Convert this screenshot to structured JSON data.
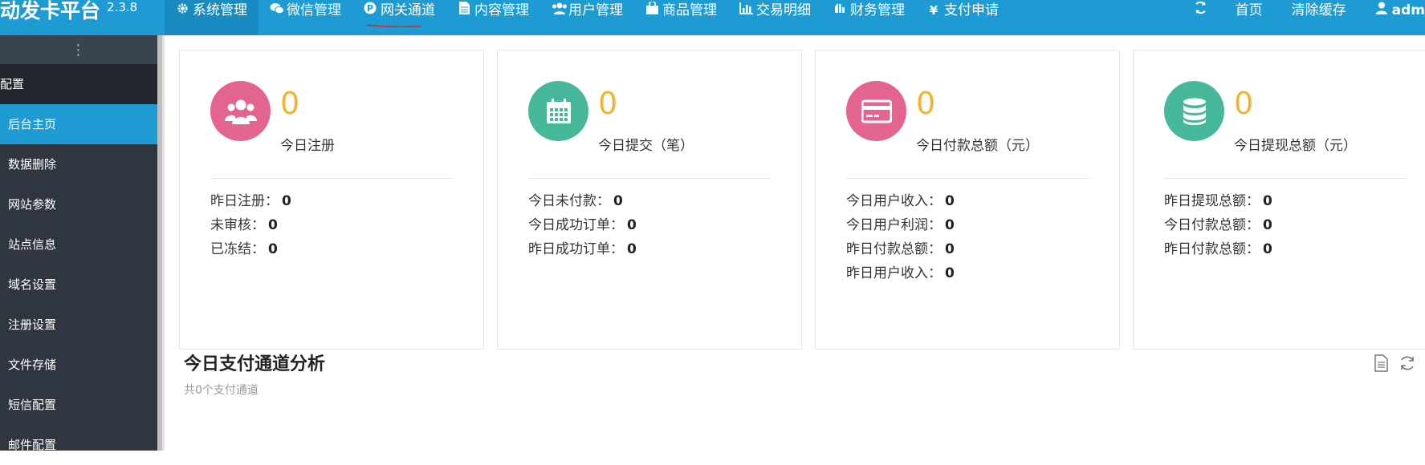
{
  "brand": {
    "name": "动发卡平台",
    "version": "2.3.8"
  },
  "nav": [
    {
      "label": "系统管理",
      "icon": "gear-icon"
    },
    {
      "label": "微信管理",
      "icon": "wechat-icon"
    },
    {
      "label": "网关通道",
      "icon": "p-circle-icon"
    },
    {
      "label": "内容管理",
      "icon": "document-icon"
    },
    {
      "label": "用户管理",
      "icon": "users-icon"
    },
    {
      "label": "商品管理",
      "icon": "bag-icon"
    },
    {
      "label": "交易明细",
      "icon": "bar-chart-icon"
    },
    {
      "label": "财务管理",
      "icon": "finance-icon"
    },
    {
      "label": "支付申请",
      "icon": "yen-icon"
    }
  ],
  "nav_right": {
    "home": "首页",
    "clear_cache": "清除缓存",
    "user": "adm"
  },
  "colors": {
    "topbar": "#1f9bd4",
    "sidebar": "#2f3640",
    "accent_number": "#f0b530",
    "underline": "#c62828"
  },
  "sidebar": {
    "group": "配置",
    "items": [
      "后台主页",
      "数据删除",
      "网站参数",
      "站点信息",
      "域名设置",
      "注册设置",
      "文件存储",
      "短信配置",
      "邮件配置"
    ]
  },
  "cards": [
    {
      "value": "0",
      "caption": "今日注册",
      "color": "#e3648c",
      "icon": "users-icon",
      "stats": [
        {
          "label": "昨日注册：",
          "value": "0"
        },
        {
          "label": "未审核：",
          "value": "0"
        },
        {
          "label": "已冻结：",
          "value": "0"
        }
      ]
    },
    {
      "value": "0",
      "caption": "今日提交（笔）",
      "color": "#48b89a",
      "icon": "calendar-icon",
      "stats": [
        {
          "label": "今日未付款：",
          "value": "0"
        },
        {
          "label": "今日成功订单：",
          "value": "0"
        },
        {
          "label": "昨日成功订单：",
          "value": "0"
        }
      ]
    },
    {
      "value": "0",
      "caption": "今日付款总额（元）",
      "color": "#e3648c",
      "icon": "credit-card-icon",
      "stats": [
        {
          "label": "今日用户收入：",
          "value": "0"
        },
        {
          "label": "今日用户利润：",
          "value": "0"
        },
        {
          "label": "昨日付款总额：",
          "value": "0"
        },
        {
          "label": "昨日用户收入：",
          "value": "0"
        }
      ]
    },
    {
      "value": "0",
      "caption": "今日提现总额（元）",
      "color": "#48b89a",
      "icon": "database-icon",
      "stats": [
        {
          "label": "昨日提现总额：",
          "value": "0"
        },
        {
          "label": "今日付款总额：",
          "value": "0"
        },
        {
          "label": "昨日付款总额：",
          "value": "0"
        }
      ]
    }
  ],
  "section": {
    "title": "今日支付通道分析",
    "subtitle": "共0个支付通道"
  }
}
